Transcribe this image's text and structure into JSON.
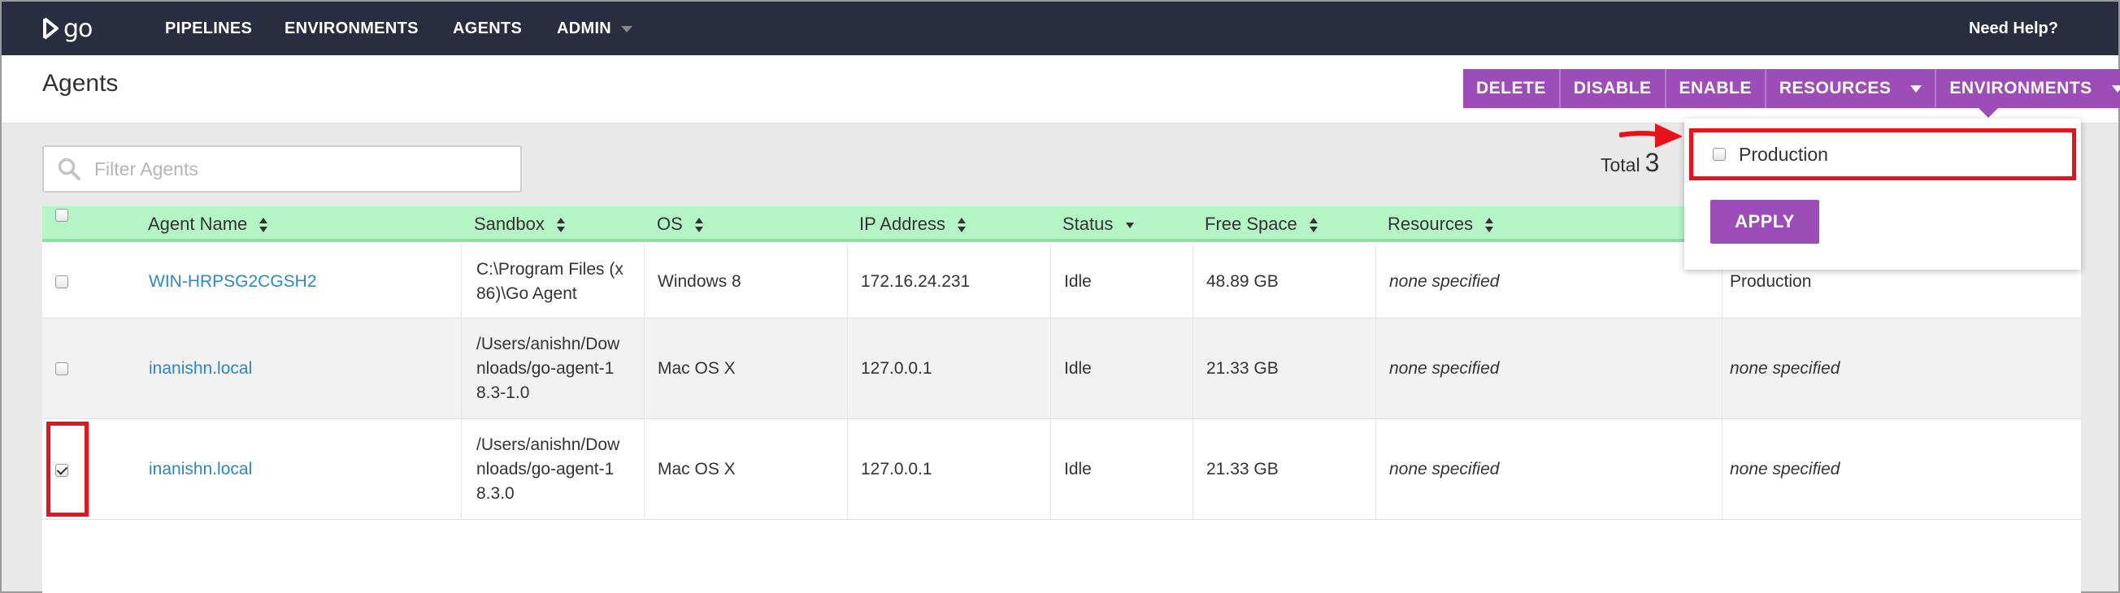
{
  "nav": {
    "logo_text": "go",
    "items": [
      "PIPELINES",
      "ENVIRONMENTS",
      "AGENTS",
      "ADMIN"
    ],
    "help": "Need Help?"
  },
  "header": {
    "title": "Agents",
    "buttons": [
      "DELETE",
      "DISABLE",
      "ENABLE",
      "RESOURCES",
      "ENVIRONMENTS"
    ]
  },
  "filter": {
    "placeholder": "Filter Agents"
  },
  "total": {
    "label": "Total",
    "value": "3"
  },
  "table": {
    "headers": [
      "Agent Name",
      "Sandbox",
      "OS",
      "IP Address",
      "Status",
      "Free Space",
      "Resources"
    ],
    "rows": [
      {
        "checked": false,
        "agent_name": "WIN-HRPSG2CGSH2",
        "sandbox": [
          "C:\\Program Files (x",
          "86)\\Go Agent"
        ],
        "os": "Windows 8",
        "ip": "172.16.24.231",
        "status": "Idle",
        "free_space": "48.89 GB",
        "resources": "none specified",
        "environments": "Production"
      },
      {
        "checked": false,
        "agent_name": "inanishn.local",
        "sandbox": [
          "/Users/anishn/Dow",
          "nloads/go-agent-1",
          "8.3-1.0"
        ],
        "os": "Mac OS X",
        "ip": "127.0.0.1",
        "status": "Idle",
        "free_space": "21.33 GB",
        "resources": "none specified",
        "environments": "none specified"
      },
      {
        "checked": true,
        "agent_name": "inanishn.local",
        "sandbox": [
          "/Users/anishn/Dow",
          "nloads/go-agent-1",
          "8.3.0"
        ],
        "os": "Mac OS X",
        "ip": "127.0.0.1",
        "status": "Idle",
        "free_space": "21.33 GB",
        "resources": "none specified",
        "environments": "none specified"
      }
    ]
  },
  "env_dropdown": {
    "option_label": "Production",
    "option_checked": false,
    "apply_label": "APPLY"
  },
  "colors": {
    "nav_bg": "#2a2c40",
    "accent": "#9c4db8",
    "table_header": "#b5f5c5",
    "link": "#2a87c8",
    "highlight": "#e8121a"
  }
}
